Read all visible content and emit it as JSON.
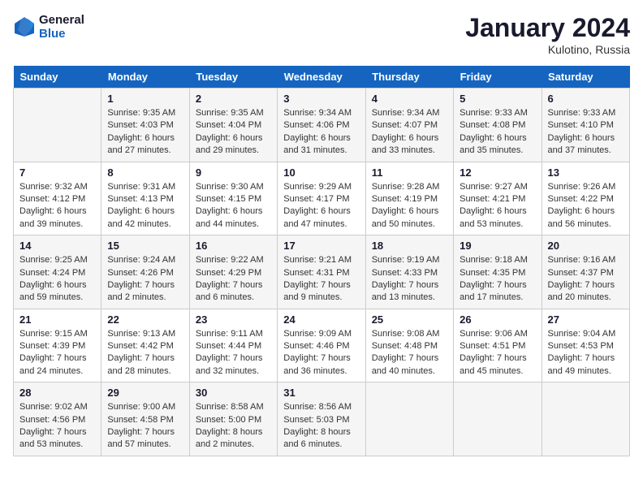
{
  "header": {
    "logo_line1": "General",
    "logo_line2": "Blue",
    "title": "January 2024",
    "subtitle": "Kulotino, Russia"
  },
  "weekdays": [
    "Sunday",
    "Monday",
    "Tuesday",
    "Wednesday",
    "Thursday",
    "Friday",
    "Saturday"
  ],
  "weeks": [
    [
      {
        "day": "",
        "info": ""
      },
      {
        "day": "1",
        "info": "Sunrise: 9:35 AM\nSunset: 4:03 PM\nDaylight: 6 hours\nand 27 minutes."
      },
      {
        "day": "2",
        "info": "Sunrise: 9:35 AM\nSunset: 4:04 PM\nDaylight: 6 hours\nand 29 minutes."
      },
      {
        "day": "3",
        "info": "Sunrise: 9:34 AM\nSunset: 4:06 PM\nDaylight: 6 hours\nand 31 minutes."
      },
      {
        "day": "4",
        "info": "Sunrise: 9:34 AM\nSunset: 4:07 PM\nDaylight: 6 hours\nand 33 minutes."
      },
      {
        "day": "5",
        "info": "Sunrise: 9:33 AM\nSunset: 4:08 PM\nDaylight: 6 hours\nand 35 minutes."
      },
      {
        "day": "6",
        "info": "Sunrise: 9:33 AM\nSunset: 4:10 PM\nDaylight: 6 hours\nand 37 minutes."
      }
    ],
    [
      {
        "day": "7",
        "info": "Sunrise: 9:32 AM\nSunset: 4:12 PM\nDaylight: 6 hours\nand 39 minutes."
      },
      {
        "day": "8",
        "info": "Sunrise: 9:31 AM\nSunset: 4:13 PM\nDaylight: 6 hours\nand 42 minutes."
      },
      {
        "day": "9",
        "info": "Sunrise: 9:30 AM\nSunset: 4:15 PM\nDaylight: 6 hours\nand 44 minutes."
      },
      {
        "day": "10",
        "info": "Sunrise: 9:29 AM\nSunset: 4:17 PM\nDaylight: 6 hours\nand 47 minutes."
      },
      {
        "day": "11",
        "info": "Sunrise: 9:28 AM\nSunset: 4:19 PM\nDaylight: 6 hours\nand 50 minutes."
      },
      {
        "day": "12",
        "info": "Sunrise: 9:27 AM\nSunset: 4:21 PM\nDaylight: 6 hours\nand 53 minutes."
      },
      {
        "day": "13",
        "info": "Sunrise: 9:26 AM\nSunset: 4:22 PM\nDaylight: 6 hours\nand 56 minutes."
      }
    ],
    [
      {
        "day": "14",
        "info": "Sunrise: 9:25 AM\nSunset: 4:24 PM\nDaylight: 6 hours\nand 59 minutes."
      },
      {
        "day": "15",
        "info": "Sunrise: 9:24 AM\nSunset: 4:26 PM\nDaylight: 7 hours\nand 2 minutes."
      },
      {
        "day": "16",
        "info": "Sunrise: 9:22 AM\nSunset: 4:29 PM\nDaylight: 7 hours\nand 6 minutes."
      },
      {
        "day": "17",
        "info": "Sunrise: 9:21 AM\nSunset: 4:31 PM\nDaylight: 7 hours\nand 9 minutes."
      },
      {
        "day": "18",
        "info": "Sunrise: 9:19 AM\nSunset: 4:33 PM\nDaylight: 7 hours\nand 13 minutes."
      },
      {
        "day": "19",
        "info": "Sunrise: 9:18 AM\nSunset: 4:35 PM\nDaylight: 7 hours\nand 17 minutes."
      },
      {
        "day": "20",
        "info": "Sunrise: 9:16 AM\nSunset: 4:37 PM\nDaylight: 7 hours\nand 20 minutes."
      }
    ],
    [
      {
        "day": "21",
        "info": "Sunrise: 9:15 AM\nSunset: 4:39 PM\nDaylight: 7 hours\nand 24 minutes."
      },
      {
        "day": "22",
        "info": "Sunrise: 9:13 AM\nSunset: 4:42 PM\nDaylight: 7 hours\nand 28 minutes."
      },
      {
        "day": "23",
        "info": "Sunrise: 9:11 AM\nSunset: 4:44 PM\nDaylight: 7 hours\nand 32 minutes."
      },
      {
        "day": "24",
        "info": "Sunrise: 9:09 AM\nSunset: 4:46 PM\nDaylight: 7 hours\nand 36 minutes."
      },
      {
        "day": "25",
        "info": "Sunrise: 9:08 AM\nSunset: 4:48 PM\nDaylight: 7 hours\nand 40 minutes."
      },
      {
        "day": "26",
        "info": "Sunrise: 9:06 AM\nSunset: 4:51 PM\nDaylight: 7 hours\nand 45 minutes."
      },
      {
        "day": "27",
        "info": "Sunrise: 9:04 AM\nSunset: 4:53 PM\nDaylight: 7 hours\nand 49 minutes."
      }
    ],
    [
      {
        "day": "28",
        "info": "Sunrise: 9:02 AM\nSunset: 4:56 PM\nDaylight: 7 hours\nand 53 minutes."
      },
      {
        "day": "29",
        "info": "Sunrise: 9:00 AM\nSunset: 4:58 PM\nDaylight: 7 hours\nand 57 minutes."
      },
      {
        "day": "30",
        "info": "Sunrise: 8:58 AM\nSunset: 5:00 PM\nDaylight: 8 hours\nand 2 minutes."
      },
      {
        "day": "31",
        "info": "Sunrise: 8:56 AM\nSunset: 5:03 PM\nDaylight: 8 hours\nand 6 minutes."
      },
      {
        "day": "",
        "info": ""
      },
      {
        "day": "",
        "info": ""
      },
      {
        "day": "",
        "info": ""
      }
    ]
  ]
}
